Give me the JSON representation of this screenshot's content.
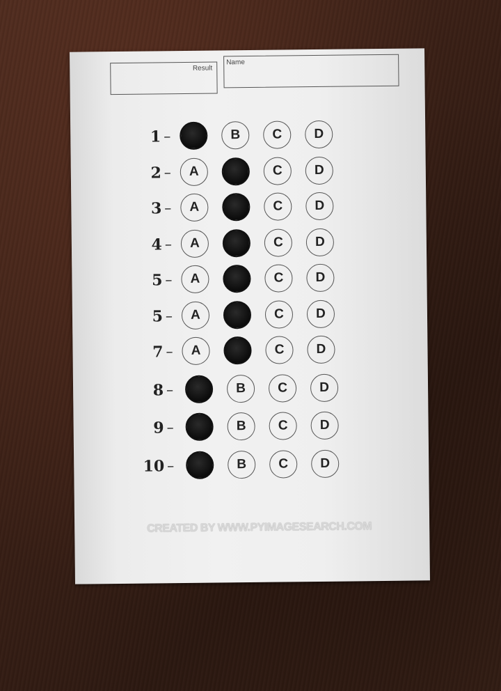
{
  "header": {
    "result_label": "Result",
    "name_label": "Name"
  },
  "questions": [
    {
      "number": "1",
      "dash": "–",
      "options": [
        "A",
        "B",
        "C",
        "D"
      ],
      "filled": "A"
    },
    {
      "number": "2",
      "dash": "–",
      "options": [
        "A",
        "B",
        "C",
        "D"
      ],
      "filled": "B"
    },
    {
      "number": "3",
      "dash": "–",
      "options": [
        "A",
        "B",
        "C",
        "D"
      ],
      "filled": "B"
    },
    {
      "number": "4",
      "dash": "–",
      "options": [
        "A",
        "B",
        "C",
        "D"
      ],
      "filled": "B"
    },
    {
      "number": "5",
      "dash": "–",
      "options": [
        "A",
        "B",
        "C",
        "D"
      ],
      "filled": "B"
    },
    {
      "number": "5",
      "dash": "–",
      "options": [
        "A",
        "B",
        "C",
        "D"
      ],
      "filled": "B"
    },
    {
      "number": "7",
      "dash": "–",
      "options": [
        "A",
        "B",
        "C",
        "D"
      ],
      "filled": "B"
    },
    {
      "number": "8",
      "dash": "–",
      "options": [
        "A",
        "B",
        "C",
        "D"
      ],
      "filled": "A"
    },
    {
      "number": "9",
      "dash": "–",
      "options": [
        "A",
        "B",
        "C",
        "D"
      ],
      "filled": "A"
    },
    {
      "number": "10",
      "dash": "–",
      "options": [
        "A",
        "B",
        "C",
        "D"
      ],
      "filled": "A"
    }
  ],
  "footer": {
    "credit": "CREATED BY WWW.PYIMAGESEARCH.COM"
  }
}
